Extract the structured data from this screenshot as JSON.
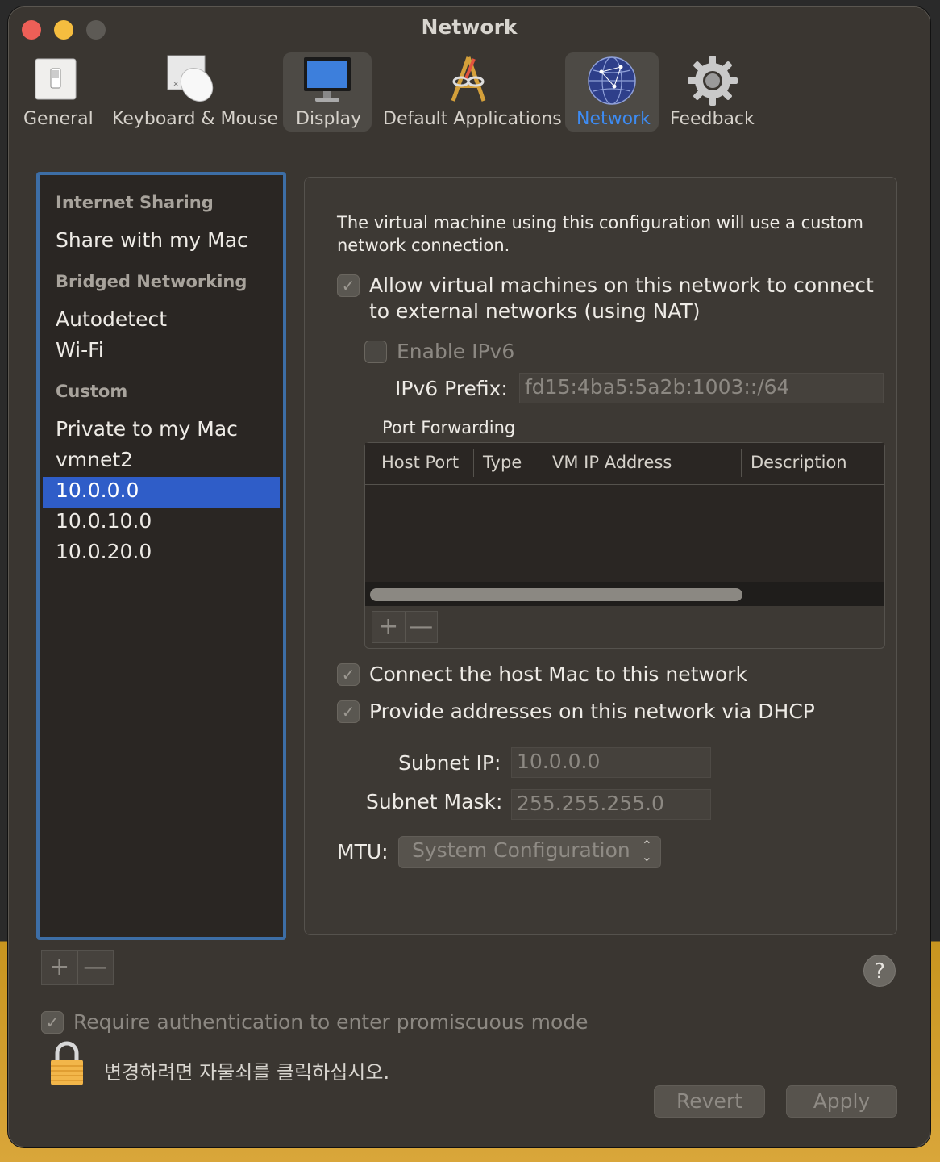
{
  "window": {
    "title": "Network"
  },
  "toolbar": [
    {
      "label": "General",
      "icon": "switch-icon"
    },
    {
      "label": "Keyboard & Mouse",
      "icon": "mouse-icon"
    },
    {
      "label": "Display",
      "icon": "monitor-icon"
    },
    {
      "label": "Default Applications",
      "icon": "applications-icon"
    },
    {
      "label": "Network",
      "icon": "globe-icon"
    },
    {
      "label": "Feedback",
      "icon": "gear-icon"
    }
  ],
  "sidebar": {
    "sections": [
      {
        "header": "Internet Sharing",
        "items": [
          "Share with my Mac"
        ]
      },
      {
        "header": "Bridged Networking",
        "items": [
          "Autodetect",
          "Wi-Fi"
        ]
      },
      {
        "header": "Custom",
        "items": [
          "Private to my Mac",
          "vmnet2",
          "10.0.0.0",
          "10.0.10.0",
          "10.0.20.0"
        ]
      }
    ],
    "selected": "10.0.0.0",
    "add_symbol": "+",
    "remove_symbol": "—"
  },
  "panel": {
    "description": "The virtual machine using this configuration will use a custom network connection.",
    "nat_label_line1": "Allow virtual machines on this network to connect",
    "nat_label_line2": "to external networks (using NAT)",
    "nat_checked": true,
    "ipv6_label": "Enable IPv6",
    "ipv6_checked": false,
    "ipv6_prefix_label": "IPv6 Prefix:",
    "ipv6_prefix_value": "fd15:4ba5:5a2b:1003::/64",
    "port_forwarding_label": "Port Forwarding",
    "pf_columns": [
      "Host Port",
      "Type",
      "VM IP Address",
      "Description"
    ],
    "pf_add_symbol": "+",
    "pf_remove_symbol": "—",
    "connect_host_label": "Connect the host Mac to this network",
    "connect_host_checked": true,
    "dhcp_label": "Provide addresses on this network via DHCP",
    "dhcp_checked": true,
    "subnet_ip_label": "Subnet IP:",
    "subnet_ip_value": "10.0.0.0",
    "subnet_mask_label": "Subnet Mask:",
    "subnet_mask_value": "255.255.255.0",
    "mtu_label": "MTU:",
    "mtu_value": "System Configuration"
  },
  "footer": {
    "help_symbol": "?",
    "promiscuous_label": "Require authentication to enter promiscuous mode",
    "promiscuous_checked": true,
    "lock_text": "변경하려면 자물쇠를 클릭하십시오.",
    "revert_label": "Revert",
    "apply_label": "Apply"
  }
}
